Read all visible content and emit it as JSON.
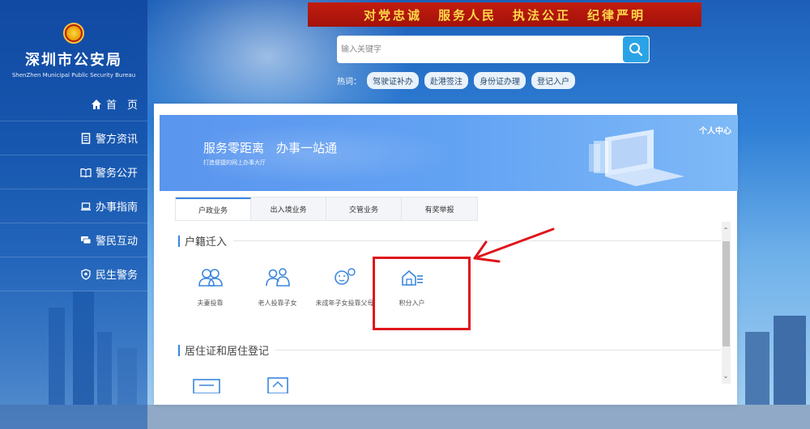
{
  "logo": {
    "cn": "深圳市公安局",
    "en": "ShenZhen Municipal Public Security Bureau"
  },
  "nav": [
    {
      "label": "首　页",
      "icon": "home-icon"
    },
    {
      "label": "警方资讯",
      "icon": "document-icon"
    },
    {
      "label": "警务公开",
      "icon": "book-icon"
    },
    {
      "label": "办事指南",
      "icon": "laptop-icon"
    },
    {
      "label": "警民互动",
      "icon": "chat-icon"
    },
    {
      "label": "民生警务",
      "icon": "police-badge-icon"
    }
  ],
  "slogan": [
    "对党忠诚",
    "服务人民",
    "执法公正",
    "纪律严明"
  ],
  "search": {
    "placeholder": "输入关键字"
  },
  "hotwords": {
    "label": "热词：",
    "items": [
      "驾驶证补办",
      "赴港签注",
      "身份证办理",
      "登记入户"
    ]
  },
  "banner": {
    "title": "服务零距离　办事一站通",
    "subtitle": "打造便捷的网上办事大厅",
    "personal_center": "个人中心"
  },
  "tabs": [
    "户政业务",
    "出入境业务",
    "交管业务",
    "有奖举报"
  ],
  "sections": {
    "household": {
      "title": "户籍迁入",
      "services": [
        "夫妻投靠",
        "老人投靠子女",
        "未成年子女投靠父母",
        "积分入户"
      ]
    },
    "residence": {
      "title": "居住证和居住登记"
    }
  },
  "colors": {
    "accent": "#3a86dd",
    "annotation": "#e0151b",
    "slogan_bg": "#b0150c",
    "slogan_text": "#ffd84a"
  }
}
